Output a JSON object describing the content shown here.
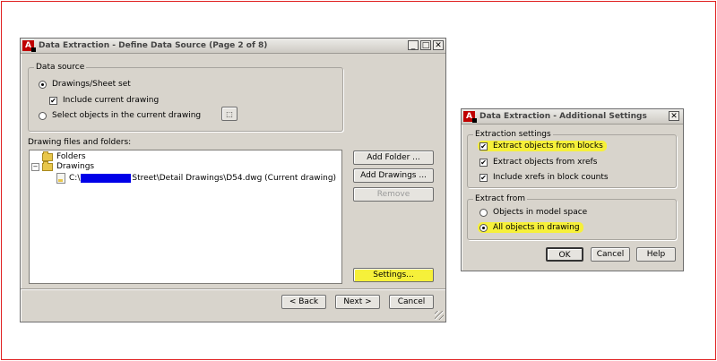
{
  "main_dialog": {
    "title": "Data Extraction - Define Data Source (Page 2 of 8)",
    "source_group_label": "Data source",
    "radio_drawings": "Drawings/Sheet set",
    "include_current": "Include current drawing",
    "radio_select": "Select objects in the current drawing",
    "files_label": "Drawing files and folders:",
    "tree": {
      "folders": "Folders",
      "drawings": "Drawings",
      "path_prefix": "C:\\",
      "path_suffix": "Street\\Detail Drawings\\D54.dwg (Current drawing)"
    },
    "buttons": {
      "add_folder": "Add Folder ...",
      "add_drawings": "Add Drawings ...",
      "remove": "Remove",
      "settings": "Settings...",
      "back": "< Back",
      "next": "Next >",
      "cancel": "Cancel"
    },
    "highlight_color": "#f6f03a"
  },
  "settings_dialog": {
    "title": "Data Extraction - Additional Settings",
    "extraction_group_label": "Extraction settings",
    "extract_blocks": "Extract objects from blocks",
    "extract_xrefs": "Extract objects from xrefs",
    "include_xrefs_counts": "Include xrefs in block counts",
    "extract_from_label": "Extract from",
    "model_space": "Objects in model space",
    "all_objects": "All objects in drawing",
    "buttons": {
      "ok": "OK",
      "cancel": "Cancel",
      "help": "Help"
    }
  }
}
